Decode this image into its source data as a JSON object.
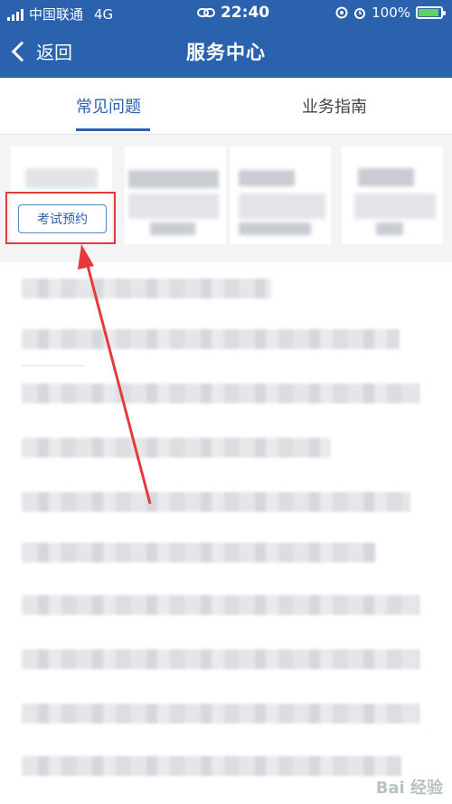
{
  "status_bar": {
    "carrier": "中国联通",
    "network": "4G",
    "time": "22:40",
    "battery": "100%"
  },
  "nav": {
    "back_label": "返回",
    "title": "服务中心"
  },
  "tabs": [
    {
      "label": "常见问题",
      "active": true
    },
    {
      "label": "业务指南",
      "active": false
    }
  ],
  "category_button": {
    "label": "考试预约"
  },
  "watermark": "Bai 经验",
  "colors": {
    "nav": "#2b62ad",
    "annotation": "#e53a3a"
  },
  "icons": [
    "signal-icon",
    "link-icon",
    "alarm-icon",
    "battery-icon",
    "back-chevron-icon",
    "arrow-annotation-icon"
  ]
}
